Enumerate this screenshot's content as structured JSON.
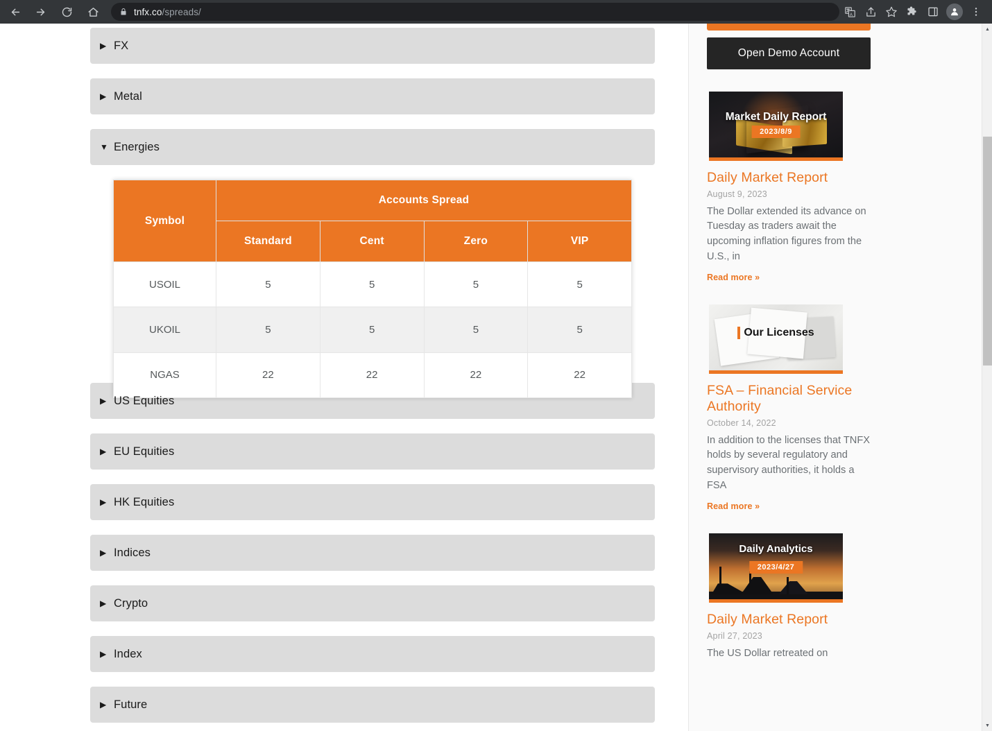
{
  "browser": {
    "back_icon": "back-arrow-icon",
    "forward_icon": "forward-arrow-icon",
    "reload_icon": "reload-icon",
    "home_icon": "home-icon",
    "lock_icon": "lock-icon",
    "url_host": "tnfx.co",
    "url_path": "/spreads/",
    "actions": [
      {
        "name": "translate-icon"
      },
      {
        "name": "share-icon"
      },
      {
        "name": "bookmark-star-icon"
      },
      {
        "name": "extensions-puzzle-icon"
      },
      {
        "name": "side-panel-icon"
      },
      {
        "name": "profile-avatar-icon"
      },
      {
        "name": "chrome-menu-icon"
      }
    ]
  },
  "main": {
    "accordion_above": [
      {
        "label": "FX",
        "marker": "▶",
        "expanded": false
      },
      {
        "label": "Metal",
        "marker": "▶",
        "expanded": false
      },
      {
        "label": "Energies",
        "marker": "▼",
        "expanded": true
      }
    ],
    "accordion_below": [
      {
        "label": "US Equities",
        "marker": "▶",
        "expanded": false
      },
      {
        "label": "EU Equities",
        "marker": "▶",
        "expanded": false
      },
      {
        "label": "HK Equities",
        "marker": "▶",
        "expanded": false
      },
      {
        "label": "Indices",
        "marker": "▶",
        "expanded": false
      },
      {
        "label": "Crypto",
        "marker": "▶",
        "expanded": false
      },
      {
        "label": "Index",
        "marker": "▶",
        "expanded": false
      },
      {
        "label": "Future",
        "marker": "▶",
        "expanded": false
      }
    ],
    "table": {
      "symbol_header": "Symbol",
      "group_header": "Accounts Spread",
      "account_columns": [
        "Standard",
        "Cent",
        "Zero",
        "VIP"
      ],
      "rows": [
        {
          "symbol": "USOIL",
          "values": [
            "5",
            "5",
            "5",
            "5"
          ]
        },
        {
          "symbol": "UKOIL",
          "values": [
            "5",
            "5",
            "5",
            "5"
          ]
        },
        {
          "symbol": "NGAS",
          "values": [
            "22",
            "22",
            "22",
            "22"
          ]
        }
      ]
    }
  },
  "sidebar": {
    "open_demo_account_label": "Open Demo Account",
    "posts": [
      {
        "thumb_title": "Market Daily Report",
        "thumb_badge": "2023/8/9",
        "title": "Daily Market Report",
        "date": "August 9, 2023",
        "excerpt": "The Dollar extended its advance on Tuesday as traders await the upcoming inflation figures from the U.S., in",
        "read_more": "Read more »"
      },
      {
        "thumb_title": "Our Licenses",
        "thumb_badge": "",
        "title": "FSA – Financial Service Authority",
        "date": "October 14, 2022",
        "excerpt": "In addition to the licenses that TNFX holds by several regulatory and supervisory authorities, it holds a FSA",
        "read_more": "Read more »"
      },
      {
        "thumb_title": "Daily Analytics",
        "thumb_badge": "2023/4/27",
        "title": "Daily Market Report",
        "date": "April 27, 2023",
        "excerpt": "The US Dollar retreated on",
        "read_more": ""
      }
    ]
  },
  "colors": {
    "accent_orange": "#eb7623",
    "accordion_gray": "#dcdcdc",
    "dark_button": "#252525",
    "toolbar_dark": "#333639"
  }
}
